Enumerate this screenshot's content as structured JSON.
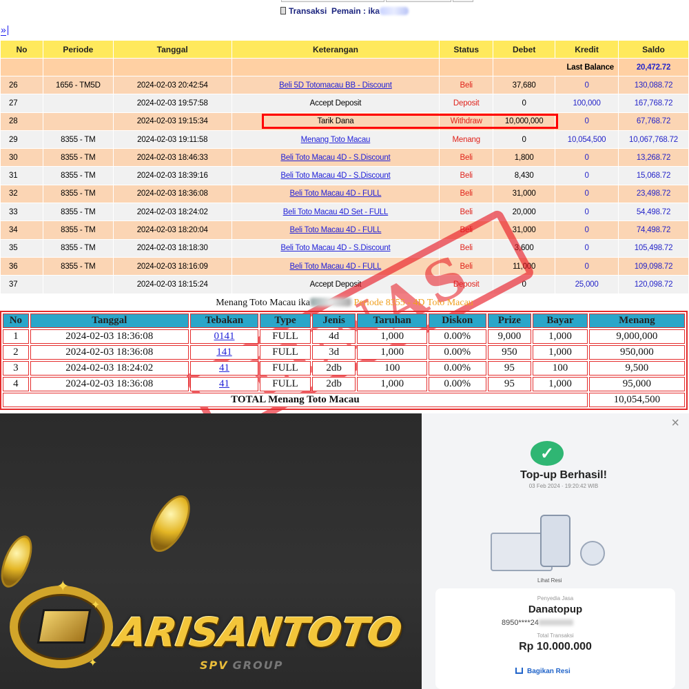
{
  "header": {
    "title_prefix": "Transaksi",
    "title_player": "Pemain : ika",
    "nav_next": "»"
  },
  "tx_table": {
    "columns": [
      "No",
      "Periode",
      "Tanggal",
      "Keterangan",
      "Status",
      "Debet",
      "Kredit",
      "Saldo"
    ],
    "last_balance_label": "Last Balance",
    "last_balance_value": "20,472.72",
    "rows": [
      {
        "no": "26",
        "periode": "1656 - TM5D",
        "tanggal": "2024-02-03 20:42:54",
        "ket": "Beli 5D Totomacau BB - Discount",
        "ket_link": true,
        "status": "Beli",
        "debet": "37,680",
        "kredit": "0",
        "saldo": "130,088.72"
      },
      {
        "no": "27",
        "periode": "",
        "tanggal": "2024-02-03 19:57:58",
        "ket": "Accept Deposit",
        "ket_link": false,
        "status": "Deposit",
        "debet": "0",
        "kredit": "100,000",
        "saldo": "167,768.72"
      },
      {
        "no": "28",
        "periode": "",
        "tanggal": "2024-02-03 19:15:34",
        "ket": "Tarik Dana",
        "ket_link": false,
        "status": "Withdraw",
        "debet": "10,000,000",
        "kredit": "0",
        "saldo": "67,768.72"
      },
      {
        "no": "29",
        "periode": "8355 - TM",
        "tanggal": "2024-02-03 19:11:58",
        "ket": "Menang Toto Macau",
        "ket_link": true,
        "status": "Menang",
        "debet": "0",
        "kredit": "10,054,500",
        "saldo": "10,067,768.72"
      },
      {
        "no": "30",
        "periode": "8355 - TM",
        "tanggal": "2024-02-03 18:46:33",
        "ket": "Beli Toto Macau 4D - S.Discount",
        "ket_link": true,
        "status": "Beli",
        "debet": "1,800",
        "kredit": "0",
        "saldo": "13,268.72"
      },
      {
        "no": "31",
        "periode": "8355 - TM",
        "tanggal": "2024-02-03 18:39:16",
        "ket": "Beli Toto Macau 4D - S.Discount",
        "ket_link": true,
        "status": "Beli",
        "debet": "8,430",
        "kredit": "0",
        "saldo": "15,068.72"
      },
      {
        "no": "32",
        "periode": "8355 - TM",
        "tanggal": "2024-02-03 18:36:08",
        "ket": "Beli Toto Macau 4D - FULL",
        "ket_link": true,
        "status": "Beli",
        "debet": "31,000",
        "kredit": "0",
        "saldo": "23,498.72"
      },
      {
        "no": "33",
        "periode": "8355 - TM",
        "tanggal": "2024-02-03 18:24:02",
        "ket": "Beli Toto Macau 4D Set - FULL",
        "ket_link": true,
        "status": "Beli",
        "debet": "20,000",
        "kredit": "0",
        "saldo": "54,498.72"
      },
      {
        "no": "34",
        "periode": "8355 - TM",
        "tanggal": "2024-02-03 18:20:04",
        "ket": "Beli Toto Macau 4D - FULL",
        "ket_link": true,
        "status": "Beli",
        "debet": "31,000",
        "kredit": "0",
        "saldo": "74,498.72"
      },
      {
        "no": "35",
        "periode": "8355 - TM",
        "tanggal": "2024-02-03 18:18:30",
        "ket": "Beli Toto Macau 4D - S.Discount",
        "ket_link": true,
        "status": "Beli",
        "debet": "3,600",
        "kredit": "0",
        "saldo": "105,498.72"
      },
      {
        "no": "36",
        "periode": "8355 - TM",
        "tanggal": "2024-02-03 18:16:09",
        "ket": "Beli Toto Macau 4D - FULL",
        "ket_link": true,
        "status": "Beli",
        "debet": "11,000",
        "kredit": "0",
        "saldo": "109,098.72"
      },
      {
        "no": "37",
        "periode": "",
        "tanggal": "2024-02-03 18:15:24",
        "ket": "Accept Deposit",
        "ket_link": false,
        "status": "Deposit",
        "debet": "0",
        "kredit": "25,000",
        "saldo": "120,098.72"
      }
    ]
  },
  "stamp": {
    "text": "LUNAS",
    "color": "#e6141e"
  },
  "win_caption": {
    "prefix": "Menang Toto Macau ika",
    "periode": "Periode 8355 - 4D Toto Macau"
  },
  "win_table": {
    "columns": [
      "No",
      "Tanggal",
      "Tebakan",
      "Type",
      "Jenis",
      "Taruhan",
      "Diskon",
      "Prize",
      "Bayar",
      "Menang"
    ],
    "rows": [
      {
        "no": "1",
        "tanggal": "2024-02-03 18:36:08",
        "tebakan": "0141",
        "type": "FULL",
        "jenis": "4d",
        "taruhan": "1,000",
        "diskon": "0.00%",
        "prize": "9,000",
        "bayar": "1,000",
        "menang": "9,000,000"
      },
      {
        "no": "2",
        "tanggal": "2024-02-03 18:36:08",
        "tebakan": "141",
        "type": "FULL",
        "jenis": "3d",
        "taruhan": "1,000",
        "diskon": "0.00%",
        "prize": "950",
        "bayar": "1,000",
        "menang": "950,000"
      },
      {
        "no": "3",
        "tanggal": "2024-02-03 18:24:02",
        "tebakan": "41",
        "type": "FULL",
        "jenis": "2db",
        "taruhan": "100",
        "diskon": "0.00%",
        "prize": "95",
        "bayar": "100",
        "menang": "9,500"
      },
      {
        "no": "4",
        "tanggal": "2024-02-03 18:36:08",
        "tebakan": "41",
        "type": "FULL",
        "jenis": "2db",
        "taruhan": "1,000",
        "diskon": "0.00%",
        "prize": "95",
        "bayar": "1,000",
        "menang": "95,000"
      }
    ],
    "total_label": "TOTAL  Menang Toto Macau",
    "total_value": "10,054,500"
  },
  "promo": {
    "logo_text": "ARISANTOTO",
    "logo_sub": "SPV",
    "logo_sub2": "GROUP"
  },
  "receipt": {
    "close": "×",
    "check": "✓",
    "title": "Top-up Berhasil!",
    "time": "03 Feb 2024 · 19:20:42 WIB",
    "lihat": "Lihat Resi",
    "provider_label": "Penyedia Jasa",
    "provider": "Danatopup",
    "account": "8950****24",
    "total_label": "Total Transaksi",
    "amount": "Rp 10.000.000",
    "share": "Bagikan Resi"
  },
  "colors": {
    "header_bg": "#ffe95c",
    "odd_row": "#fbd5b4",
    "even_row": "#f1f1f1",
    "win_header": "#2aa6c9",
    "accent_red": "#e42a2a",
    "success_green": "#2fb673"
  }
}
